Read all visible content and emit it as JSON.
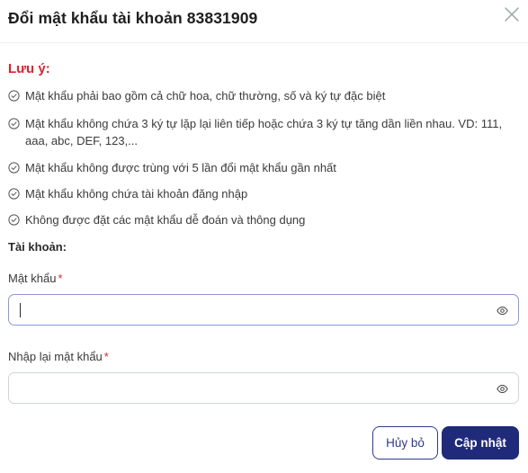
{
  "dialog": {
    "title": "Đổi mật khẩu tài khoản 83831909"
  },
  "notes": {
    "title": "Lưu ý:",
    "rules": [
      "Mật khẩu phải bao gồm cả chữ hoa, chữ thường, số và ký tự đặc biệt",
      "Mật khẩu không chứa 3 ký tự lặp lại liên tiếp hoặc chứa 3 ký tự tăng dần liền nhau. VD: 111, aaa, abc, DEF, 123,...",
      "Mật khẩu không được trùng với 5 lần đổi mật khẩu gần nhất",
      "Mật khẩu không chứa tài khoản đăng nhập",
      "Không được đặt các mật khẩu dễ đoán và thông dụng"
    ]
  },
  "form": {
    "account_label": "Tài khoản:",
    "password": {
      "label": "Mật khẩu",
      "required_mark": "*",
      "value": "",
      "visibility_icon": "eye-icon"
    },
    "confirm_password": {
      "label": "Nhập lại mật khẩu",
      "required_mark": "*",
      "value": "",
      "visibility_icon": "eye-icon"
    }
  },
  "actions": {
    "cancel_label": "Hủy bỏ",
    "submit_label": "Cập nhật"
  },
  "colors": {
    "accent": "#1f2a7a",
    "warning": "#e0212b",
    "focus_border": "#8e96d6"
  }
}
